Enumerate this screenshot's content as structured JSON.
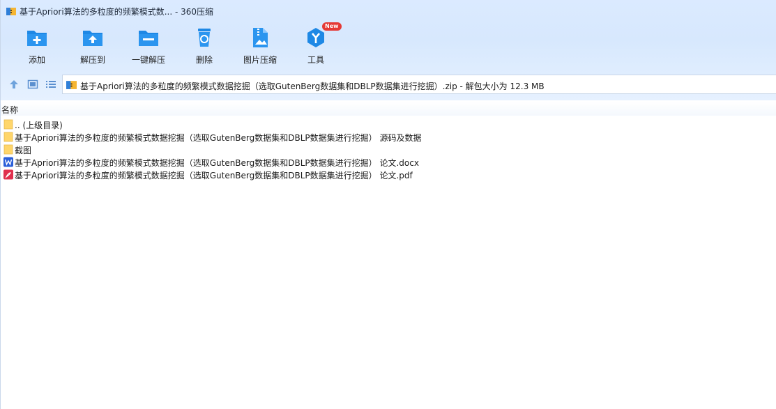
{
  "window": {
    "title": "基于Apriori算法的多粒度的频繁模式数... - 360压缩"
  },
  "toolbar": {
    "items": [
      {
        "label": "添加",
        "icon": "add-folder-icon"
      },
      {
        "label": "解压到",
        "icon": "extract-to-icon"
      },
      {
        "label": "一键解压",
        "icon": "one-click-extract-icon"
      },
      {
        "label": "删除",
        "icon": "delete-icon"
      },
      {
        "label": "图片压缩",
        "icon": "image-compress-icon"
      },
      {
        "label": "工具",
        "icon": "tools-icon",
        "badge": "New"
      }
    ]
  },
  "nav": {
    "path": "基于Apriori算法的多粒度的频繁模式数据挖掘（选取GutenBerg数据集和DBLP数据集进行挖掘）.zip - 解包大小为 12.3 MB"
  },
  "list": {
    "column_name": "名称",
    "rows": [
      {
        "name": ".. (上级目录)",
        "icon": "folder-icon"
      },
      {
        "name": "基于Apriori算法的多粒度的频繁模式数据挖掘（选取GutenBerg数据集和DBLP数据集进行挖掘） 源码及数据",
        "icon": "folder-icon"
      },
      {
        "name": "截图",
        "icon": "folder-icon"
      },
      {
        "name": "基于Apriori算法的多粒度的频繁模式数据挖掘（选取GutenBerg数据集和DBLP数据集进行挖掘） 论文.docx",
        "icon": "word-doc-icon"
      },
      {
        "name": "基于Apriori算法的多粒度的频繁模式数据挖掘（选取GutenBerg数据集和DBLP数据集进行挖掘） 论文.pdf",
        "icon": "pdf-icon"
      }
    ]
  },
  "colors": {
    "accent": "#1e88e5",
    "toolbar_bg": "#dbeaff",
    "folder": "#ffd66b",
    "word": "#2b5fd9",
    "pdf": "#e0304e"
  }
}
